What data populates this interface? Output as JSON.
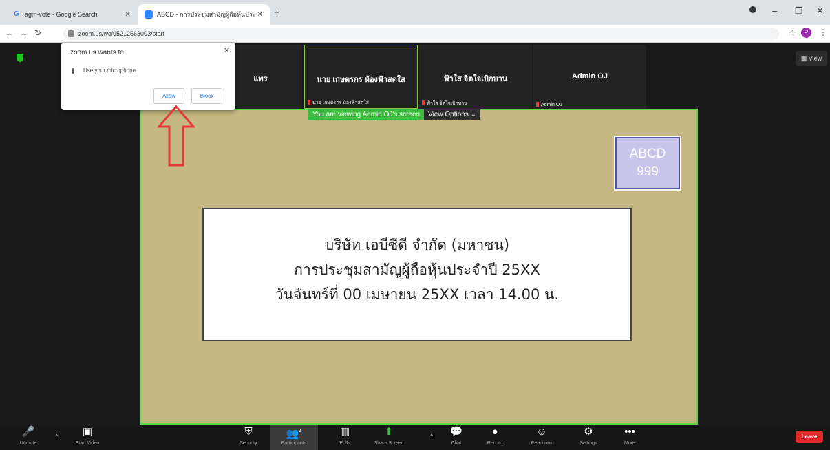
{
  "browser": {
    "tabs": [
      {
        "title": "agm-vote - Google Search",
        "favicon": "google-icon"
      },
      {
        "title": "ABCD - การประชุมสามัญผู้ถือหุ้นประ",
        "favicon": "zoom-icon"
      }
    ],
    "url": "zoom.us/wc/95212563003/start",
    "profile_initial": "P"
  },
  "popup": {
    "title": "zoom.us wants to",
    "permission": "Use your microphone",
    "allow_label": "Allow",
    "block_label": "Block"
  },
  "participants": [
    {
      "name": "แพร",
      "label": ""
    },
    {
      "name": "นาย เกษตรกร ห้องฟ้าสดใส",
      "label": "นาย เกษตรกร ห้องฟ้าสดใส"
    },
    {
      "name": "ฟ้าใส จิตใจเบิกบาน",
      "label": "ฟ้าใส จิตใจเบิกบาน"
    },
    {
      "name": "Admin OJ",
      "label": "Admin OJ"
    }
  ],
  "view_button": "View",
  "banner": {
    "viewing": "You are viewing Admin OJ's screen",
    "options": "View Options ⌄"
  },
  "slide": {
    "logo_line1": "ABCD",
    "logo_line2": "999",
    "line1": "บริษัท เอบีซีดี จำกัด (มหาชน)",
    "line2": "การประชุมสามัญผู้ถือหุ้นประจำปี 25XX",
    "line3": "วันจันทร์ที่ 00 เมษายน 25XX เวลา 14.00 น."
  },
  "toolbar": {
    "unmute": "Unmute",
    "start_video": "Start Video",
    "security": "Security",
    "participants": "Participants",
    "participants_count": "4",
    "polls": "Polls",
    "share_screen": "Share Screen",
    "chat": "Chat",
    "record": "Record",
    "reactions": "Reactions",
    "settings": "Settings",
    "more": "More",
    "leave": "Leave"
  },
  "colors": {
    "share_border": "#5ed845",
    "share_bg": "#c6b882",
    "banner_green": "#3cbb3c",
    "leave_red": "#e02828",
    "arrow_red": "#e53935"
  }
}
